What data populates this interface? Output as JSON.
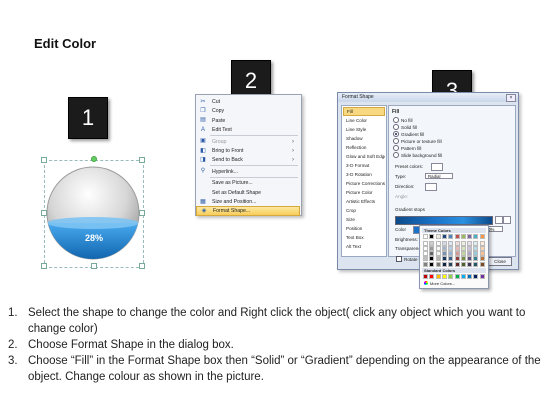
{
  "title": "Edit Color",
  "steps_badges": [
    "1",
    "2",
    "3"
  ],
  "sphere": {
    "label": "28%",
    "fill_color": "#1e88d6",
    "fill_fraction": 0.28
  },
  "context_menu": {
    "items": [
      {
        "label": "Cut",
        "icon": "scissors-icon",
        "disabled": false,
        "submenu": false,
        "highlight": false
      },
      {
        "label": "Copy",
        "icon": "copy-icon",
        "disabled": false,
        "submenu": false,
        "highlight": false
      },
      {
        "label": "Paste",
        "icon": "paste-icon",
        "disabled": false,
        "submenu": false,
        "highlight": false
      },
      {
        "label": "Edit Text",
        "icon": "text-icon",
        "disabled": false,
        "submenu": false,
        "highlight": false
      },
      {
        "label": "Group",
        "icon": "group-icon",
        "disabled": true,
        "submenu": true,
        "highlight": false
      },
      {
        "label": "Bring to Front",
        "icon": "bring-front-icon",
        "disabled": false,
        "submenu": true,
        "highlight": false
      },
      {
        "label": "Send to Back",
        "icon": "send-back-icon",
        "disabled": false,
        "submenu": true,
        "highlight": false
      },
      {
        "label": "Hyperlink...",
        "icon": "hyperlink-icon",
        "disabled": false,
        "submenu": false,
        "highlight": false
      },
      {
        "label": "Save as Picture...",
        "icon": "",
        "disabled": false,
        "submenu": false,
        "highlight": false
      },
      {
        "label": "Set as Default Shape",
        "icon": "",
        "disabled": false,
        "submenu": false,
        "highlight": false
      },
      {
        "label": "Size and Position...",
        "icon": "size-icon",
        "disabled": false,
        "submenu": false,
        "highlight": false
      },
      {
        "label": "Format Shape...",
        "icon": "format-shape-icon",
        "disabled": false,
        "submenu": false,
        "highlight": true
      }
    ]
  },
  "format_dialog": {
    "title": "Format Shape",
    "nav": [
      "Fill",
      "Line Color",
      "Line Style",
      "Shadow",
      "Reflection",
      "Glow and Soft Edges",
      "3-D Format",
      "3-D Rotation",
      "Picture Corrections",
      "Picture Color",
      "Artistic Effects",
      "Crop",
      "Size",
      "Position",
      "Text Box",
      "Alt Text"
    ],
    "panel_heading": "Fill",
    "fill_options": [
      {
        "label": "No fill",
        "selected": false
      },
      {
        "label": "Solid fill",
        "selected": false
      },
      {
        "label": "Gradient fill",
        "selected": true
      },
      {
        "label": "Picture or texture fill",
        "selected": false
      },
      {
        "label": "Pattern fill",
        "selected": false
      },
      {
        "label": "Slide background fill",
        "selected": false
      }
    ],
    "preset_colors": "Preset colors:",
    "type_label": "Type:",
    "type_value": "Radial",
    "direction_label": "Direction:",
    "angle_label": "Angle:",
    "gradient_stops": "Gradient stops",
    "color_label": "Color",
    "position_label": "Position:",
    "position_value": "0%",
    "brightness_label": "Brightness:",
    "transparency_label": "Transparency:",
    "rotate_label": "Rotate with shape",
    "close_button": "Close"
  },
  "palette": {
    "theme_colors_label": "Theme Colors",
    "standard_colors_label": "Standard Colors",
    "more_colors": "More Colors...",
    "theme_top": [
      "#ffffff",
      "#000000",
      "#eeece1",
      "#1f497d",
      "#4f81bd",
      "#c0504d",
      "#9bbb59",
      "#8064a2",
      "#4bacc6",
      "#f79646"
    ],
    "standard": [
      "#c00000",
      "#ff0000",
      "#ffc000",
      "#ffff00",
      "#92d050",
      "#00b050",
      "#00b0f0",
      "#0070c0",
      "#002060",
      "#7030a0"
    ]
  },
  "instructions": [
    {
      "num": "1.",
      "text": "Select the shape to change the color and Right click the object( click any object which you want to change color)"
    },
    {
      "num": "2.",
      "text": "Choose Format Shape in the dialog box."
    },
    {
      "num": "3.",
      "text": "Choose “Fill” in the Format Shape box then “Solid” or “Gradient” depending on the appearance of the object. Change colour as shown in the picture."
    }
  ]
}
